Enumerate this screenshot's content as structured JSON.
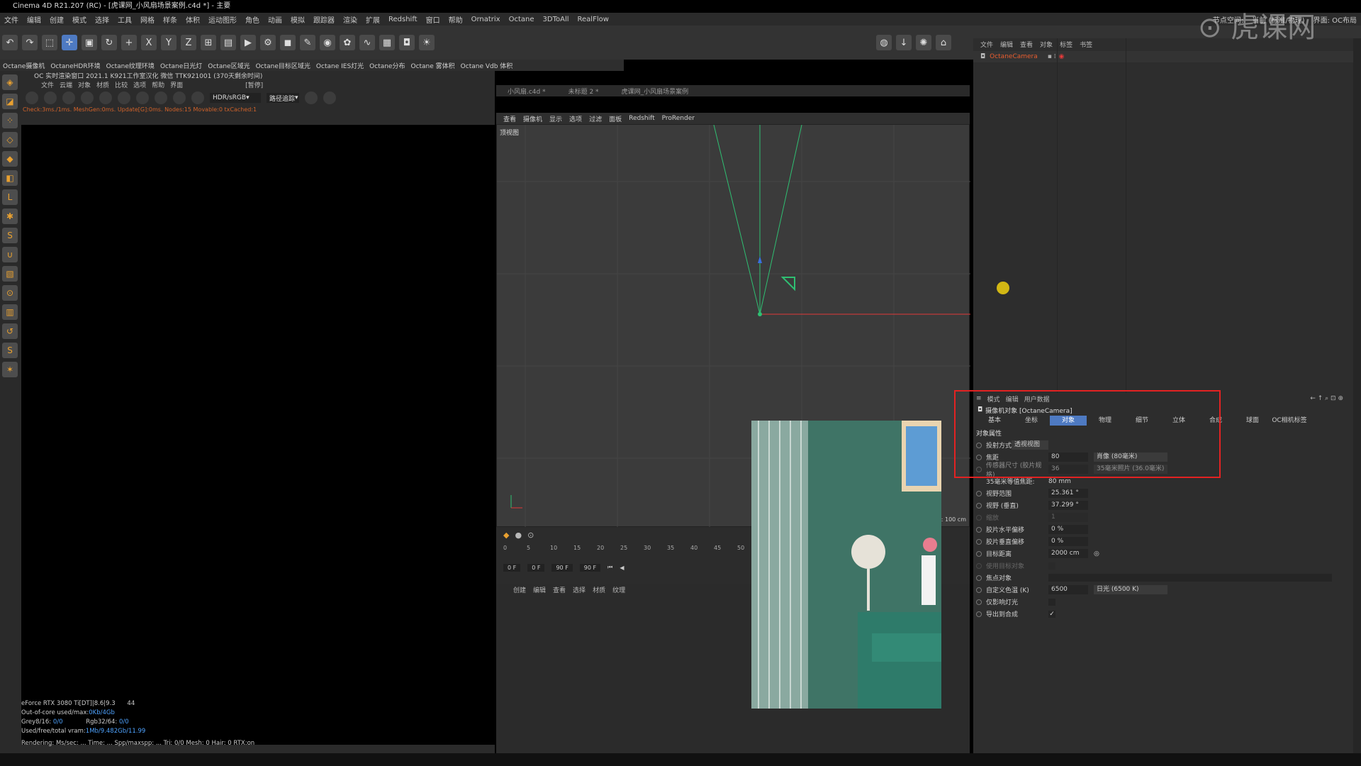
{
  "titlebar": {
    "title": "Cinema 4D R21.207 (RC) - [虎课网_小风扇场景案例.c4d *] - 主要"
  },
  "menubar": {
    "items": [
      "文件",
      "编辑",
      "创建",
      "模式",
      "选择",
      "工具",
      "网格",
      "样条",
      "体积",
      "运动图形",
      "角色",
      "动画",
      "模拟",
      "跟踪器",
      "渲染",
      "扩展",
      "Redshift",
      "窗口",
      "帮助",
      "Ornatrix",
      "Octane",
      "3DToAll",
      "RealFlow"
    ],
    "right_label": "节点空间:",
    "right_value": "当前 (标准/物理)",
    "right_suffix": "界面: OC布局"
  },
  "octbar": {
    "items": [
      "Octane摄像机",
      "OctaneHDR环境",
      "Octane纹理环境",
      "Octane日光灯",
      "Octane区域光",
      "Octane目标区域光",
      "Octane IES灯光",
      "Octane分布",
      "Octane 雾体积",
      "Octane Vdb 体积"
    ]
  },
  "ocpanel": {
    "header": "OC 实时渲染窗口 2021.1  K921工作室汉化 微信 TTK921001 (370天剩余时间)",
    "menu": [
      "文件",
      "云端",
      "对象",
      "材质",
      "比较",
      "选项",
      "帮助",
      "界面"
    ],
    "menu_tag": "[暂停]",
    "color_mode": "HDR/sRGB",
    "kernel": "路径追踪",
    "status": "Check:3ms./1ms. MeshGen:0ms. Update[G]:0ms. Nodes:15 Movable:0 txCached:1"
  },
  "stats": {
    "gpu": "eForce RTX 3080 Ti[DT]|8.6|9.3",
    "gpu_count": "44",
    "outofcore": "Out-of-core used/max:",
    "outofcore_val": "0Kb/4Gb",
    "grey": "Grey8/16:",
    "grey_val": "0/0",
    "rgb": "Rgb32/64:",
    "rgb_val": "0/0",
    "vram": "Used/free/total vram:",
    "vram_val": "1Mb/9.482Gb/11.99",
    "rendering": "Rendering:   Ms/sec: ...  Time: ...    Spp/maxspp: ...  Tri: 0/0  Mesh: 0    Hair: 0  RTX:on"
  },
  "vptabs": [
    "小风扇.c4d *",
    "未标题 2 *",
    "虎课网_小风扇场景案例"
  ],
  "vpmenu": [
    "查看",
    "摄像机",
    "显示",
    "选项",
    "过滤",
    "面板",
    "Redshift",
    "ProRender"
  ],
  "viewport": {
    "label": "顶视图",
    "scale": "网格间距 : 100 cm"
  },
  "timeline": {
    "ticks": [
      "0",
      "5",
      "10",
      "15",
      "20",
      "25",
      "30",
      "35",
      "40",
      "45",
      "50"
    ],
    "frame_start": "0 F",
    "frame_cur": "0 F",
    "frame_end": "90 F",
    "frame_end2": "90 F"
  },
  "matpanel": {
    "tabs": [
      "创建",
      "编辑",
      "查看",
      "选择",
      "材质",
      "纹理"
    ]
  },
  "objmanager": {
    "menu": [
      "文件",
      "编辑",
      "查看",
      "对象",
      "标签",
      "书签"
    ],
    "object": "OctaneCamera"
  },
  "attr": {
    "menu": [
      "模式",
      "编辑",
      "用户数据"
    ],
    "title": "摄像机对象 [OctaneCamera]",
    "tabs": [
      "基本",
      "坐标",
      "对象",
      "物理",
      "细节",
      "立体",
      "合成",
      "球面",
      "OC相机标签"
    ],
    "active_tab": "对象",
    "section": "对象属性",
    "projection_label": "投射方式",
    "projection_value": "透视视图",
    "focal_label": "焦距",
    "focal_value": "80",
    "focal_dd": "肖像 (80毫米)",
    "sensor_label": "传感器尺寸 (胶片规格)",
    "sensor_value": "36",
    "sensor_dd": "35毫米照片 (36.0毫米)",
    "equiv_label": "35毫米等值焦距:",
    "equiv_value": "80 mm",
    "fov_h_label": "视野范围",
    "fov_h_value": "25.361 °",
    "fov_v_label": "视野 (垂直)",
    "fov_v_value": "37.299 °",
    "zoom_label": "缩放",
    "zoom_value": "1",
    "offx_label": "胶片水平偏移",
    "offx_value": "0 %",
    "offy_label": "胶片垂直偏移",
    "offy_value": "0 %",
    "target_label": "目标距离",
    "target_value": "2000 cm",
    "usetarget_label": "使用目标对象",
    "focus_label": "焦点对象",
    "wb_label": "自定义色温 (K)",
    "wb_value": "6500",
    "wb_dd": "日光 (6500 K)",
    "affect_label": "仅影响灯光",
    "export_label": "导出到合成"
  },
  "colors": {
    "accent": "#4e7ac2",
    "highlight_box": "#e32222",
    "status_text": "#d0622a"
  }
}
